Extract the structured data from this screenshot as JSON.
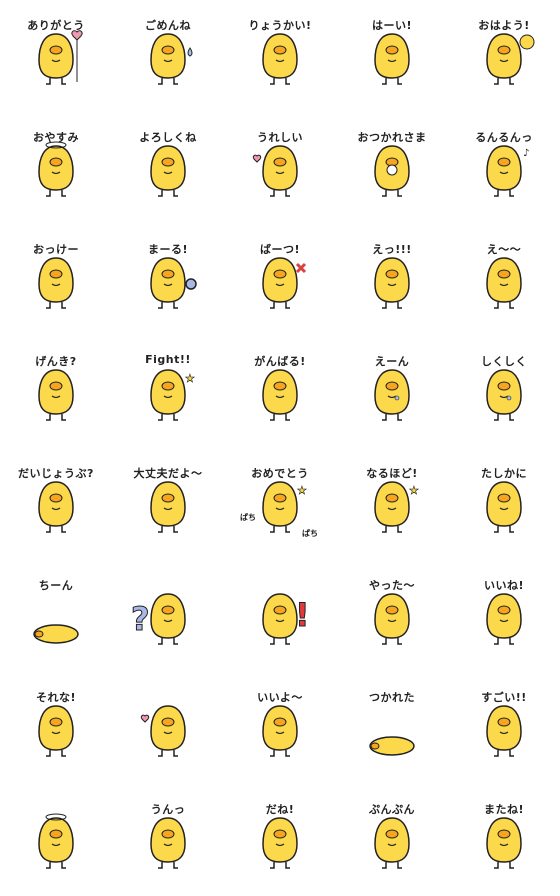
{
  "colors": {
    "body": "#FCD94A",
    "beak": "#F7A41E",
    "outline": "#222222",
    "background": "#FFFFFF"
  },
  "stickers": [
    {
      "label": "ありがとう",
      "prop": "heart-balloon"
    },
    {
      "label": "ごめんね",
      "prop": "sweat-drop"
    },
    {
      "label": "りょうかい!",
      "prop": ""
    },
    {
      "label": "はーい!",
      "prop": ""
    },
    {
      "label": "おはよう!",
      "prop": "sun"
    },
    {
      "label": "おやすみ",
      "prop": "moon"
    },
    {
      "label": "よろしくね",
      "prop": ""
    },
    {
      "label": "うれしい",
      "prop": "hearts"
    },
    {
      "label": "おつかれさま",
      "prop": "flower"
    },
    {
      "label": "るんるんっ",
      "prop": "music-notes"
    },
    {
      "label": "おっけー",
      "prop": ""
    },
    {
      "label": "まーる!",
      "prop": "circle"
    },
    {
      "label": "ばーつ!",
      "prop": "cross"
    },
    {
      "label": "えっ!!!",
      "prop": ""
    },
    {
      "label": "え〜〜",
      "prop": ""
    },
    {
      "label": "げんき?",
      "prop": ""
    },
    {
      "label": "Fight!!",
      "prop": "stars"
    },
    {
      "label": "がんばる!",
      "prop": ""
    },
    {
      "label": "えーん",
      "prop": "tears"
    },
    {
      "label": "しくしく",
      "prop": "tear"
    },
    {
      "label": "だいじょうぶ?",
      "prop": ""
    },
    {
      "label": "大丈夫だよ〜",
      "prop": ""
    },
    {
      "label": "おめでとう",
      "prop": "party-hat",
      "extras": [
        "ぱち",
        "ぱち"
      ]
    },
    {
      "label": "なるほど!",
      "prop": "sparkle"
    },
    {
      "label": "たしかに",
      "prop": ""
    },
    {
      "label": "ちーん",
      "prop": "lying"
    },
    {
      "label": "",
      "prop": "question-mark"
    },
    {
      "label": "",
      "prop": "exclamation-mark"
    },
    {
      "label": "やった〜",
      "prop": ""
    },
    {
      "label": "いいね!",
      "prop": ""
    },
    {
      "label": "それな!",
      "prop": ""
    },
    {
      "label": "",
      "prop": "hearts"
    },
    {
      "label": "いいよ〜",
      "prop": ""
    },
    {
      "label": "つかれた",
      "prop": "lying"
    },
    {
      "label": "すごい!!",
      "prop": ""
    },
    {
      "label": "",
      "prop": "halo"
    },
    {
      "label": "うんっ",
      "prop": ""
    },
    {
      "label": "だね!",
      "prop": ""
    },
    {
      "label": "ぷんぷん",
      "prop": ""
    },
    {
      "label": "またね!",
      "prop": ""
    }
  ]
}
